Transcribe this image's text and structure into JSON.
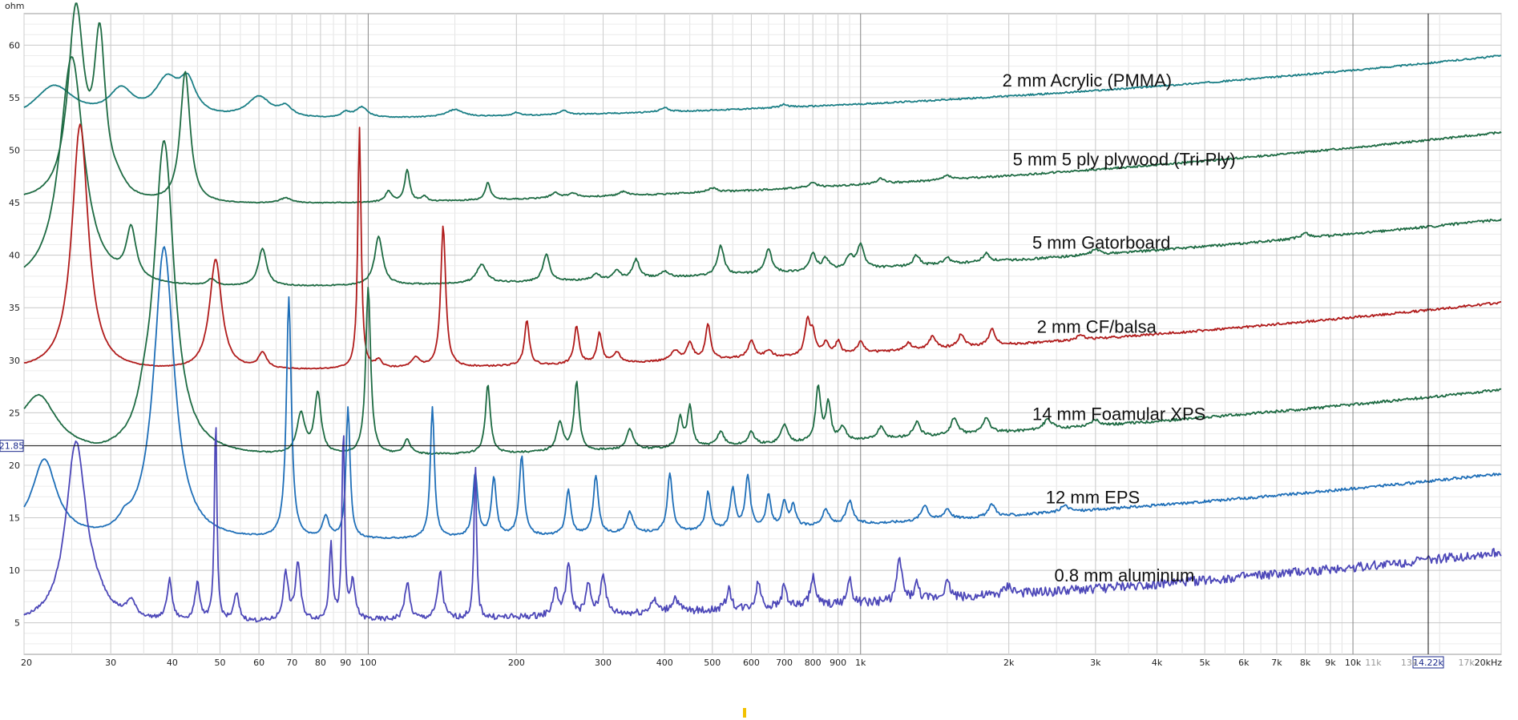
{
  "chart_data": {
    "type": "line",
    "ylabel": "ohm",
    "xscale": "log",
    "xlim": [
      20,
      20000
    ],
    "ylim": [
      2,
      63
    ],
    "grid": true,
    "x_ticks_major": [
      {
        "v": 20,
        "l": "20"
      },
      {
        "v": 30,
        "l": "30"
      },
      {
        "v": 40,
        "l": "40"
      },
      {
        "v": 50,
        "l": "50"
      },
      {
        "v": 60,
        "l": "60"
      },
      {
        "v": 70,
        "l": "70"
      },
      {
        "v": 80,
        "l": "80"
      },
      {
        "v": 90,
        "l": "90"
      },
      {
        "v": 100,
        "l": "100"
      },
      {
        "v": 200,
        "l": "200"
      },
      {
        "v": 300,
        "l": "300"
      },
      {
        "v": 400,
        "l": "400"
      },
      {
        "v": 500,
        "l": "500"
      },
      {
        "v": 600,
        "l": "600"
      },
      {
        "v": 700,
        "l": "700"
      },
      {
        "v": 800,
        "l": "800"
      },
      {
        "v": 900,
        "l": "900"
      },
      {
        "v": 1000,
        "l": "1k"
      },
      {
        "v": 2000,
        "l": "2k"
      },
      {
        "v": 3000,
        "l": "3k"
      },
      {
        "v": 4000,
        "l": "4k"
      },
      {
        "v": 5000,
        "l": "5k"
      },
      {
        "v": 6000,
        "l": "6k"
      },
      {
        "v": 7000,
        "l": "7k"
      },
      {
        "v": 8000,
        "l": "8k"
      },
      {
        "v": 9000,
        "l": "9k"
      },
      {
        "v": 10000,
        "l": "10k"
      },
      {
        "v": 20000,
        "l": "20kHz"
      }
    ],
    "x_ticks_minor": [
      {
        "v": 11000,
        "l": "11k"
      },
      {
        "v": 13000,
        "l": "13k"
      },
      {
        "v": 17000,
        "l": "17k"
      }
    ],
    "y_ticks": [
      5,
      10,
      15,
      20,
      25,
      30,
      35,
      40,
      45,
      50,
      55,
      60
    ],
    "cursor": {
      "y": 21.85,
      "y_label": "21.85",
      "x": 14220,
      "x_label": "14.22k"
    },
    "series": [
      {
        "name": "2 mm Acrylic (PMMA)",
        "color": "#1b7f86",
        "baseline": 52.8,
        "hf_gain": 6.2,
        "hf_power": 2.4,
        "start": 52.6,
        "noise": 0.05,
        "seed": 11,
        "label_x": 2000,
        "peaks": [
          [
            23,
            3.3,
            0.05
          ],
          [
            31.5,
            2.5,
            0.03
          ],
          [
            39,
            3.4,
            0.03
          ],
          [
            43,
            3.0,
            0.02
          ],
          [
            60,
            2.0,
            0.03
          ],
          [
            68,
            0.9,
            0.015
          ],
          [
            90,
            0.5,
            0.01
          ],
          [
            97,
            1.0,
            0.015
          ],
          [
            150,
            0.7,
            0.02
          ],
          [
            200,
            0.3,
            0.01
          ],
          [
            250,
            0.4,
            0.01
          ],
          [
            400,
            0.4,
            0.01
          ],
          [
            700,
            0.3,
            0.01
          ]
        ]
      },
      {
        "name": "5 mm 5 ply plywood (Tri-Ply)",
        "color": "#1e6b43",
        "baseline": 44.7,
        "hf_gain": 7.0,
        "hf_power": 2.2,
        "start": 45.0,
        "noise": 0.06,
        "seed": 23,
        "label_x": 2100,
        "peaks": [
          [
            25.5,
            18.0,
            0.02
          ],
          [
            28.5,
            14.5,
            0.014
          ],
          [
            42.5,
            12.5,
            0.012
          ],
          [
            31,
            1.0,
            0.02
          ],
          [
            68,
            0.5,
            0.015
          ],
          [
            110,
            1.0,
            0.008
          ],
          [
            120,
            3.0,
            0.006
          ],
          [
            130,
            0.5,
            0.006
          ],
          [
            175,
            1.7,
            0.006
          ],
          [
            240,
            0.5,
            0.01
          ],
          [
            260,
            0.4,
            0.01
          ],
          [
            330,
            0.4,
            0.01
          ],
          [
            500,
            0.4,
            0.01
          ],
          [
            800,
            0.4,
            0.01
          ],
          [
            1100,
            0.5,
            0.01
          ],
          [
            1500,
            0.4,
            0.01
          ]
        ]
      },
      {
        "name": "5 mm Gatorboard",
        "color": "#1e6b43",
        "baseline": 36.8,
        "hf_gain": 6.6,
        "hf_power": 2.2,
        "start": 36.9,
        "noise": 0.07,
        "seed": 37,
        "label_x": 2300,
        "peaks": [
          [
            25,
            22.0,
            0.03
          ],
          [
            33,
            4.8,
            0.012
          ],
          [
            48,
            0.6,
            0.01
          ],
          [
            61,
            3.6,
            0.01
          ],
          [
            105,
            4.6,
            0.01
          ],
          [
            170,
            1.8,
            0.012
          ],
          [
            230,
            2.6,
            0.008
          ],
          [
            290,
            0.6,
            0.008
          ],
          [
            320,
            0.8,
            0.008
          ],
          [
            350,
            1.8,
            0.008
          ],
          [
            400,
            0.6,
            0.01
          ],
          [
            520,
            2.8,
            0.008
          ],
          [
            650,
            2.3,
            0.008
          ],
          [
            800,
            1.6,
            0.008
          ],
          [
            850,
            1.1,
            0.008
          ],
          [
            950,
            1.2,
            0.008
          ],
          [
            1000,
            2.3,
            0.008
          ],
          [
            1300,
            1.0,
            0.008
          ],
          [
            1500,
            0.6,
            0.008
          ],
          [
            1800,
            0.8,
            0.008
          ],
          [
            3000,
            0.5,
            0.01
          ],
          [
            8000,
            0.5,
            0.01
          ]
        ]
      },
      {
        "name": "2 mm CF/balsa",
        "color": "#b01b1b",
        "baseline": 28.9,
        "hf_gain": 6.6,
        "hf_power": 2.3,
        "start": 29.0,
        "noise": 0.07,
        "seed": 41,
        "label_x": 2350,
        "peaks": [
          [
            26,
            23.5,
            0.02
          ],
          [
            49,
            10.5,
            0.015
          ],
          [
            61,
            1.5,
            0.01
          ],
          [
            96,
            23.0,
            0.004
          ],
          [
            105,
            0.7,
            0.008
          ],
          [
            125,
            0.9,
            0.01
          ],
          [
            142,
            13.5,
            0.006
          ],
          [
            210,
            4.3,
            0.006
          ],
          [
            265,
            3.6,
            0.006
          ],
          [
            295,
            2.9,
            0.006
          ],
          [
            320,
            1.0,
            0.008
          ],
          [
            420,
            0.9,
            0.01
          ],
          [
            450,
            1.6,
            0.008
          ],
          [
            490,
            3.4,
            0.006
          ],
          [
            600,
            1.6,
            0.008
          ],
          [
            650,
            0.6,
            0.008
          ],
          [
            780,
            3.2,
            0.006
          ],
          [
            800,
            2.0,
            0.006
          ],
          [
            850,
            1.2,
            0.006
          ],
          [
            900,
            1.2,
            0.006
          ],
          [
            1000,
            1.0,
            0.008
          ],
          [
            1250,
            0.7,
            0.008
          ],
          [
            1400,
            1.2,
            0.008
          ],
          [
            1600,
            1.2,
            0.008
          ],
          [
            1850,
            1.5,
            0.008
          ],
          [
            2800,
            0.4,
            0.01
          ]
        ]
      },
      {
        "name": "14 mm Foamular XPS",
        "color": "#1e6b43",
        "baseline": 20.6,
        "hf_gain": 6.6,
        "hf_power": 2.3,
        "start": 22.5,
        "noise": 0.08,
        "seed": 53,
        "label_x": 2300,
        "peaks": [
          [
            21.5,
            4.3,
            0.04
          ],
          [
            35,
            1.4,
            0.015
          ],
          [
            38.5,
            30.0,
            0.025
          ],
          [
            73,
            3.8,
            0.01
          ],
          [
            79,
            5.8,
            0.008
          ],
          [
            100,
            16.0,
            0.006
          ],
          [
            120,
            1.4,
            0.008
          ],
          [
            175,
            6.5,
            0.006
          ],
          [
            245,
            2.7,
            0.008
          ],
          [
            265,
            6.5,
            0.006
          ],
          [
            340,
            1.9,
            0.008
          ],
          [
            430,
            2.8,
            0.006
          ],
          [
            450,
            3.8,
            0.006
          ],
          [
            520,
            1.4,
            0.008
          ],
          [
            600,
            1.2,
            0.008
          ],
          [
            700,
            1.8,
            0.008
          ],
          [
            820,
            5.2,
            0.006
          ],
          [
            860,
            3.5,
            0.006
          ],
          [
            920,
            1.2,
            0.008
          ],
          [
            1100,
            1.1,
            0.008
          ],
          [
            1300,
            1.4,
            0.008
          ],
          [
            1550,
            1.6,
            0.008
          ],
          [
            1800,
            1.5,
            0.008
          ],
          [
            2400,
            0.9,
            0.01
          ],
          [
            3000,
            0.6,
            0.01
          ]
        ]
      },
      {
        "name": "12 mm EPS",
        "color": "#1f6fb8",
        "baseline": 12.6,
        "hf_gain": 6.6,
        "hf_power": 2.3,
        "start": 13.3,
        "noise": 0.08,
        "seed": 67,
        "label_x": 2450,
        "peaks": [
          [
            22,
            7.2,
            0.03
          ],
          [
            32,
            0.8,
            0.012
          ],
          [
            38.5,
            28.0,
            0.025
          ],
          [
            69,
            23.0,
            0.006
          ],
          [
            82,
            2.0,
            0.008
          ],
          [
            91,
            12.5,
            0.005
          ],
          [
            135,
            12.5,
            0.005
          ],
          [
            165,
            6.0,
            0.006
          ],
          [
            180,
            5.5,
            0.006
          ],
          [
            205,
            7.6,
            0.006
          ],
          [
            255,
            4.3,
            0.006
          ],
          [
            290,
            5.6,
            0.006
          ],
          [
            340,
            2.0,
            0.008
          ],
          [
            410,
            5.6,
            0.006
          ],
          [
            490,
            3.6,
            0.006
          ],
          [
            550,
            3.8,
            0.006
          ],
          [
            590,
            5.0,
            0.006
          ],
          [
            650,
            3.0,
            0.006
          ],
          [
            700,
            2.3,
            0.006
          ],
          [
            730,
            2.0,
            0.006
          ],
          [
            850,
            1.5,
            0.008
          ],
          [
            950,
            2.2,
            0.008
          ],
          [
            1350,
            1.5,
            0.008
          ],
          [
            1500,
            1.0,
            0.008
          ],
          [
            1850,
            1.2,
            0.008
          ],
          [
            2600,
            0.6,
            0.01
          ]
        ]
      },
      {
        "name": "0.8 mm aluminum",
        "color": "#4c47b8",
        "baseline": 4.9,
        "hf_gain": 6.8,
        "hf_power": 2.2,
        "start": 4.8,
        "noise": 0.28,
        "seed": 79,
        "label_x": 2550,
        "peaks": [
          [
            25.5,
            17.0,
            0.025
          ],
          [
            28,
            1.0,
            0.03
          ],
          [
            33,
            1.5,
            0.01
          ],
          [
            39.5,
            3.8,
            0.006
          ],
          [
            45,
            3.5,
            0.006
          ],
          [
            49,
            19.5,
            0.003
          ],
          [
            54,
            2.6,
            0.006
          ],
          [
            68,
            4.5,
            0.006
          ],
          [
            72,
            5.5,
            0.006
          ],
          [
            84,
            7.4,
            0.004
          ],
          [
            89,
            18.5,
            0.003
          ],
          [
            93,
            3.5,
            0.006
          ],
          [
            120,
            3.5,
            0.006
          ],
          [
            140,
            4.5,
            0.006
          ],
          [
            165,
            15.0,
            0.003
          ],
          [
            240,
            2.5,
            0.006
          ],
          [
            255,
            4.8,
            0.006
          ],
          [
            280,
            2.8,
            0.006
          ],
          [
            300,
            3.9,
            0.006
          ],
          [
            380,
            1.2,
            0.008
          ],
          [
            420,
            1.3,
            0.008
          ],
          [
            540,
            2.0,
            0.006
          ],
          [
            620,
            2.5,
            0.006
          ],
          [
            700,
            2.0,
            0.006
          ],
          [
            800,
            2.8,
            0.006
          ],
          [
            950,
            2.2,
            0.006
          ],
          [
            1200,
            4.0,
            0.006
          ],
          [
            1300,
            1.5,
            0.006
          ],
          [
            1500,
            1.5,
            0.008
          ],
          [
            2000,
            0.8,
            0.01
          ]
        ]
      }
    ]
  }
}
